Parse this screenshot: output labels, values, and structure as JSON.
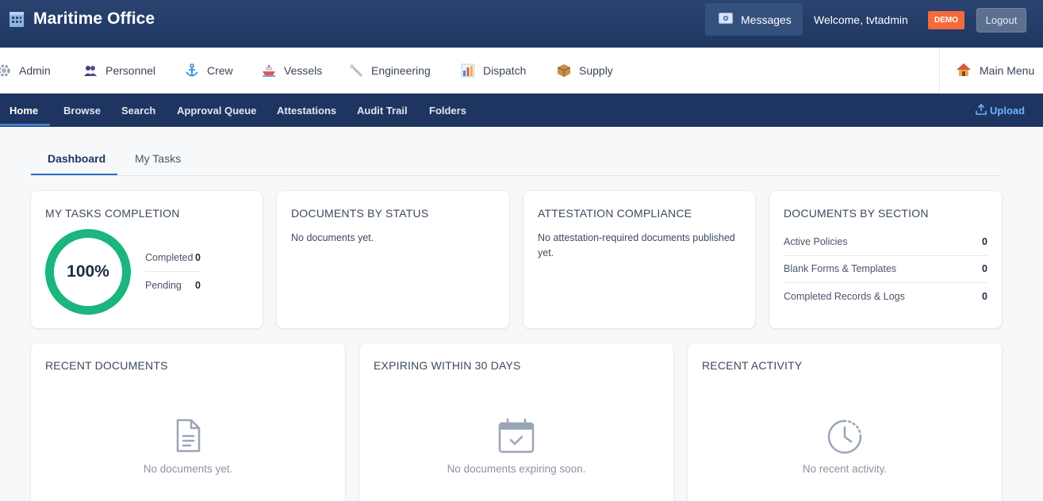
{
  "header": {
    "title": "Maritime Office",
    "messages_label": "Messages",
    "welcome_text": "Welcome, tvtadmin",
    "demo_badge": "DEMO",
    "logout_label": "Logout"
  },
  "modules": {
    "items": [
      {
        "label": "Admin",
        "icon": "gear-icon"
      },
      {
        "label": "Personnel",
        "icon": "people-icon"
      },
      {
        "label": "Crew",
        "icon": "anchor-icon"
      },
      {
        "label": "Vessels",
        "icon": "ship-icon"
      },
      {
        "label": "Engineering",
        "icon": "wrench-icon"
      },
      {
        "label": "Dispatch",
        "icon": "bar-chart-icon"
      },
      {
        "label": "Supply",
        "icon": "package-icon"
      }
    ],
    "main_menu": "Main Menu"
  },
  "nav": {
    "items": [
      "Home",
      "Browse",
      "Search",
      "Approval Queue",
      "Attestations",
      "Audit Trail",
      "Folders"
    ],
    "active": "Home",
    "upload_label": "Upload"
  },
  "tabs": {
    "dashboard": "Dashboard",
    "my_tasks": "My Tasks",
    "active": "Dashboard"
  },
  "cards": {
    "tasks_completion": {
      "title": "MY TASKS COMPLETION",
      "percent": "100%",
      "completed_label": "Completed",
      "completed_value": "0",
      "pending_label": "Pending",
      "pending_value": "0"
    },
    "documents_by_status": {
      "title": "DOCUMENTS BY STATUS",
      "message": "No documents yet."
    },
    "attestation_compliance": {
      "title": "ATTESTATION COMPLIANCE",
      "message": "No attestation-required documents published yet."
    },
    "documents_by_section": {
      "title": "DOCUMENTS BY SECTION",
      "rows": [
        {
          "label": "Active Policies",
          "value": "0"
        },
        {
          "label": "Blank Forms & Templates",
          "value": "0"
        },
        {
          "label": "Completed Records & Logs",
          "value": "0"
        }
      ]
    },
    "recent_documents": {
      "title": "RECENT DOCUMENTS",
      "empty": "No documents yet."
    },
    "expiring": {
      "title": "EXPIRING WITHIN 30 DAYS",
      "empty": "No documents expiring soon."
    },
    "recent_activity": {
      "title": "RECENT ACTIVITY",
      "empty": "No recent activity."
    }
  },
  "colors": {
    "header_bg": "#1f3760",
    "nav_bg": "#1d3560",
    "accent": "#2d6fc0",
    "donut": "#1bb57d",
    "demo_badge": "#f26b3a"
  }
}
